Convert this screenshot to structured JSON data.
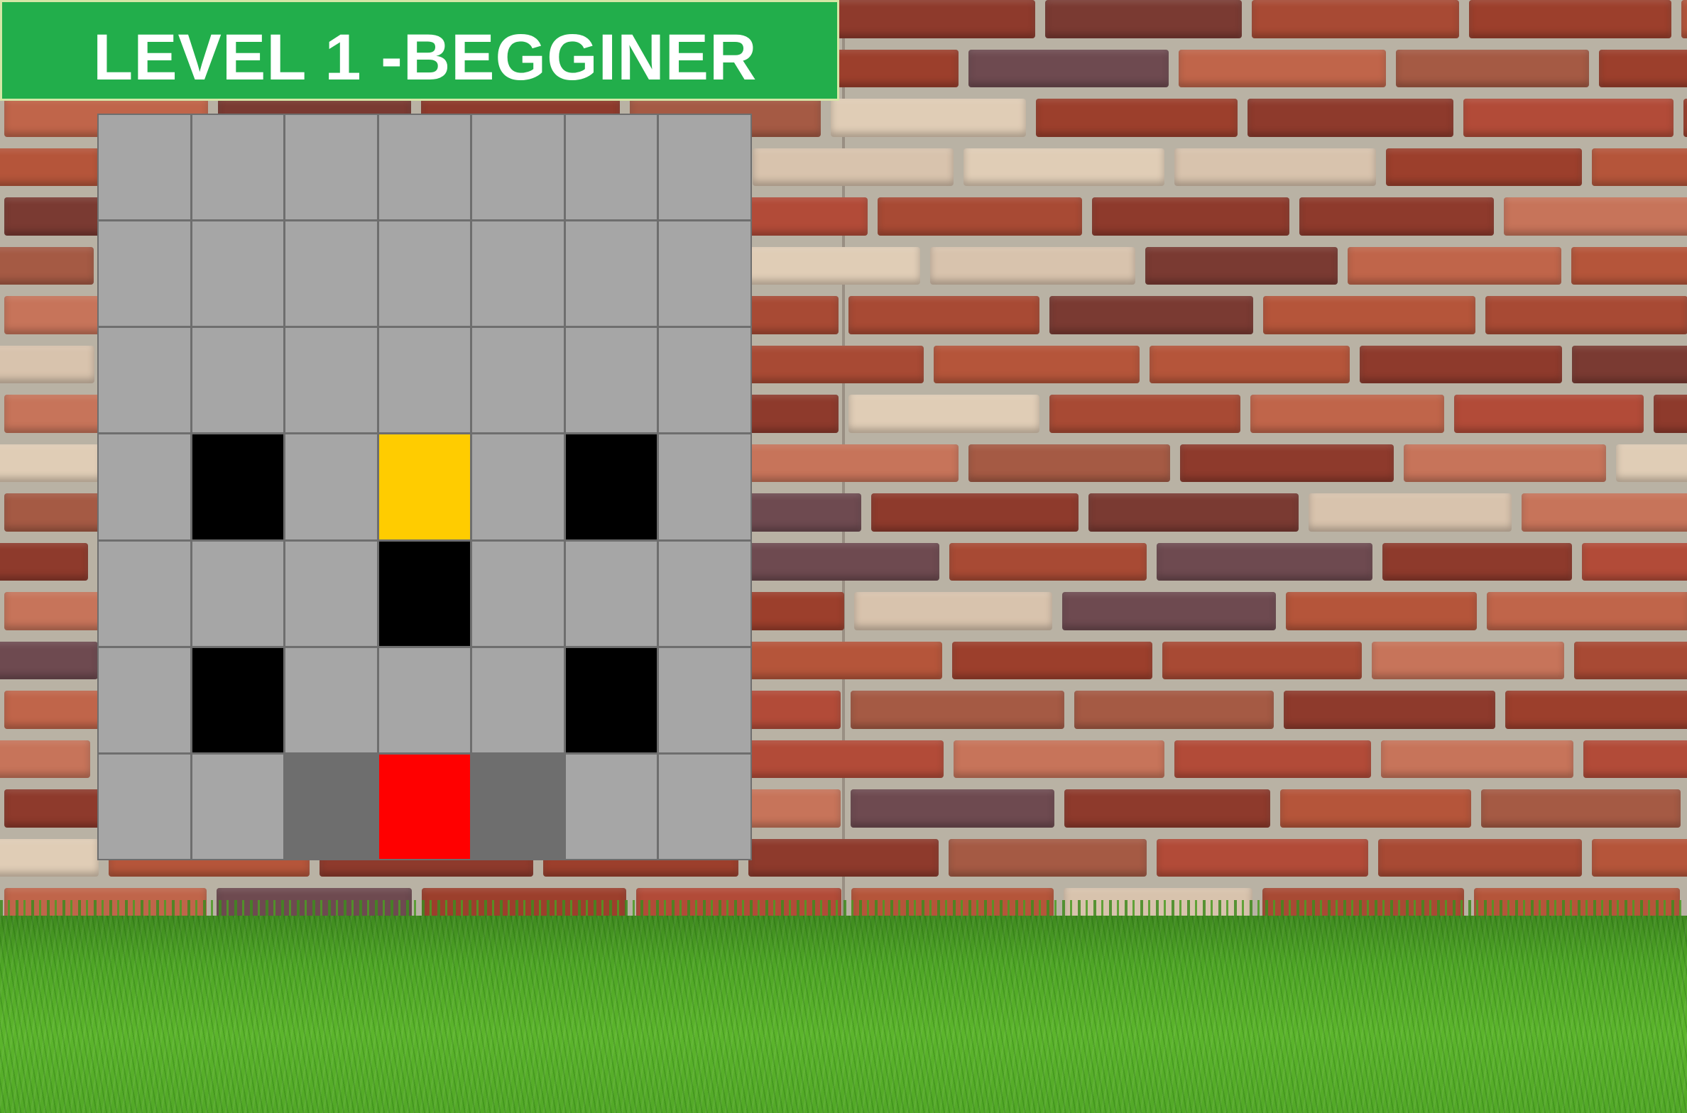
{
  "title": "LEVEL 1 -BEGGINER",
  "colors": {
    "banner": "#22ae4b",
    "floor": "#a6a6a6",
    "wall": "#000000",
    "goal": "#ffcc00",
    "player": "#ff0000",
    "shaded": "#6e6e6e"
  },
  "board": {
    "rows": 7,
    "cols": 7,
    "cells": [
      [
        "floor",
        "floor",
        "floor",
        "floor",
        "floor",
        "floor",
        "floor"
      ],
      [
        "floor",
        "floor",
        "floor",
        "floor",
        "floor",
        "floor",
        "floor"
      ],
      [
        "floor",
        "floor",
        "floor",
        "floor",
        "floor",
        "floor",
        "floor"
      ],
      [
        "floor",
        "wall",
        "floor",
        "gold",
        "floor",
        "wall",
        "floor"
      ],
      [
        "floor",
        "floor",
        "floor",
        "wall",
        "floor",
        "floor",
        "floor"
      ],
      [
        "floor",
        "wall",
        "floor",
        "floor",
        "floor",
        "wall",
        "floor"
      ],
      [
        "floor",
        "floor",
        "shade",
        "player",
        "shade",
        "floor",
        "floor"
      ]
    ]
  }
}
